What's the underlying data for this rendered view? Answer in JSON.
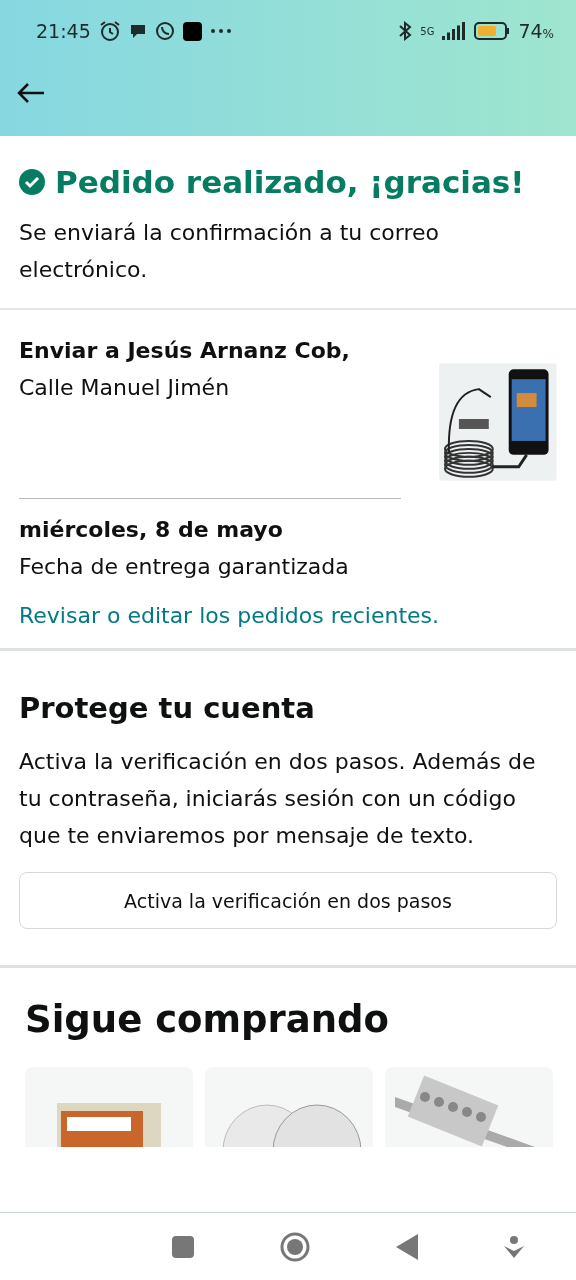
{
  "status_bar": {
    "time": "21:45",
    "network": "5G",
    "battery": "74",
    "battery_unit": "%"
  },
  "confirmation": {
    "title": "Pedido realizado, ¡gracias!",
    "subtitle": "Se enviará la confirmación a tu correo electrónico."
  },
  "shipping": {
    "recipient": "Enviar a Jesús Arnanz Cob,",
    "address_line": "Calle Manuel Jimén",
    "delivery_date": "miércoles, 8 de mayo",
    "delivery_note": "Fecha de entrega garantizada",
    "link": "Revisar o editar los pedidos recientes."
  },
  "security": {
    "title": "Protege tu cuenta",
    "body": "Activa la verificación en dos pasos. Además de tu contraseña, iniciarás sesión con un código que te enviaremos por mensaje de texto.",
    "button": "Activa la verificación en dos pasos"
  },
  "keep_shopping": {
    "title": "Sigue comprando"
  }
}
